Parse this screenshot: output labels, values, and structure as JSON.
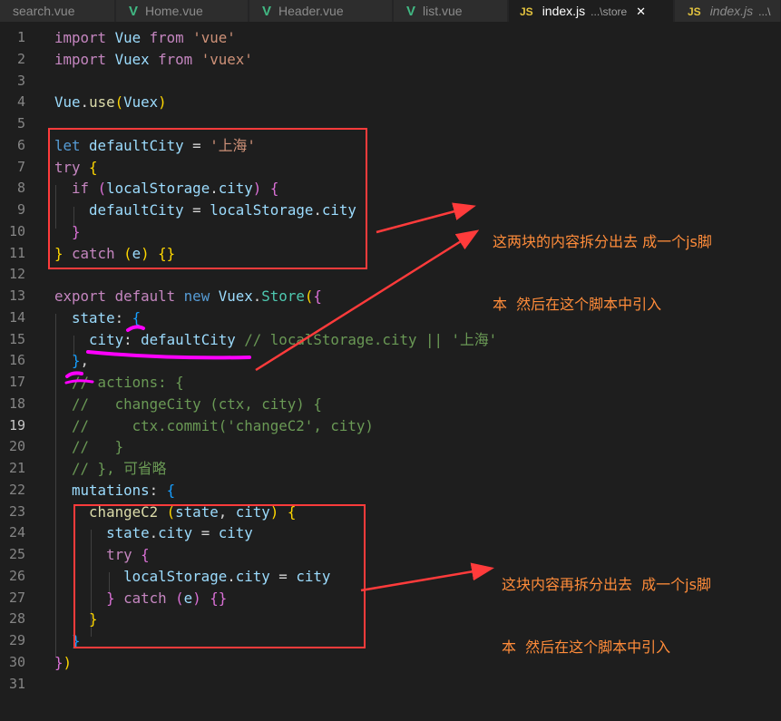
{
  "tabs": [
    {
      "icon": "",
      "name": "search.vue",
      "desc": "",
      "active": false
    },
    {
      "icon": "V",
      "name": "Home.vue",
      "desc": "",
      "active": false
    },
    {
      "icon": "V",
      "name": "Header.vue",
      "desc": "",
      "active": false
    },
    {
      "icon": "V",
      "name": "list.vue",
      "desc": "",
      "active": false
    },
    {
      "icon": "JS",
      "name": "index.js",
      "desc": "...\\store",
      "active": true,
      "close": "✕"
    },
    {
      "icon": "JS",
      "name": "index.js",
      "desc": "...\\",
      "active": false
    }
  ],
  "line_numbers": [
    "1",
    "2",
    "3",
    "4",
    "5",
    "6",
    "7",
    "8",
    "9",
    "10",
    "11",
    "12",
    "13",
    "14",
    "15",
    "16",
    "17",
    "18",
    "19",
    "20",
    "21",
    "22",
    "23",
    "24",
    "25",
    "26",
    "27",
    "28",
    "29",
    "30",
    "31"
  ],
  "current_line": "19",
  "code": {
    "l1": {
      "a": "import ",
      "b": "Vue",
      "c": " from ",
      "d": "'vue'"
    },
    "l2": {
      "a": "import ",
      "b": "Vuex",
      "c": " from ",
      "d": "'vuex'"
    },
    "l4": {
      "a": "Vue",
      "b": ".",
      "c": "use",
      "d": "(",
      "e": "Vuex",
      "f": ")"
    },
    "l6": {
      "a": "let ",
      "b": "defaultCity",
      "c": " = ",
      "d": "'上海'"
    },
    "l7": {
      "a": "try ",
      "b": "{"
    },
    "l8": {
      "a": "  if ",
      "b": "(",
      "c": "localStorage",
      "d": ".",
      "e": "city",
      "f": ") ",
      "g": "{"
    },
    "l9": {
      "a": "    defaultCity",
      "b": " = ",
      "c": "localStorage",
      "d": ".",
      "e": "city"
    },
    "l10": {
      "a": "  }"
    },
    "l11": {
      "a": "}",
      "b": " catch ",
      "c": "(",
      "d": "e",
      "e": ") ",
      "f": "{}"
    },
    "l13": {
      "a": "export ",
      "b": "default ",
      "c": "new ",
      "d": "Vuex",
      "e": ".",
      "f": "Store",
      "g": "(",
      "h": "{"
    },
    "l14": {
      "a": "  state",
      "b": ": ",
      "c": "{"
    },
    "l15": {
      "a": "    city",
      "b": ": ",
      "c": "defaultCity",
      "d": " // localStorage.city || '上海'"
    },
    "l16": {
      "a": "  }",
      "b": ","
    },
    "l17": {
      "a": "  // actions: {"
    },
    "l18": {
      "a": "  //   changeCity (ctx, city) {"
    },
    "l19": {
      "a": "  //     ctx.commit('changeC2', city)"
    },
    "l20": {
      "a": "  //   }"
    },
    "l21": {
      "a": "  // }, 可省略"
    },
    "l22": {
      "a": "  mutations",
      "b": ": ",
      "c": "{"
    },
    "l23": {
      "a": "    changeC2 ",
      "b": "(",
      "c": "state",
      "d": ", ",
      "e": "city",
      "f": ") ",
      "g": "{"
    },
    "l24": {
      "a": "      state",
      "b": ".",
      "c": "city",
      "d": " = ",
      "e": "city"
    },
    "l25": {
      "a": "      try ",
      "b": "{"
    },
    "l26": {
      "a": "        localStorage",
      "b": ".",
      "c": "city",
      "d": " = ",
      "e": "city"
    },
    "l27": {
      "a": "      }",
      "b": " catch ",
      "c": "(",
      "d": "e",
      "e": ") ",
      "f": "{}"
    },
    "l28": {
      "a": "    }"
    },
    "l29": {
      "a": "  }"
    },
    "l30": {
      "a": "}",
      "b": ")"
    }
  },
  "annotations": {
    "note1_line1": "这两块的内容拆分出去 成一个js脚",
    "note1_line2": "本  然后在这个脚本中引入",
    "note2_line1": "这块内容再拆分出去  成一个js脚",
    "note2_line2": "本  然后在这个脚本中引入"
  },
  "colors": {
    "annotation_red": "#ff3b3b",
    "annotation_magenta": "#ff00ff",
    "note_orange": "#ff8c3a",
    "vue_green": "#41b883",
    "js_yellow": "#e3c33f"
  }
}
